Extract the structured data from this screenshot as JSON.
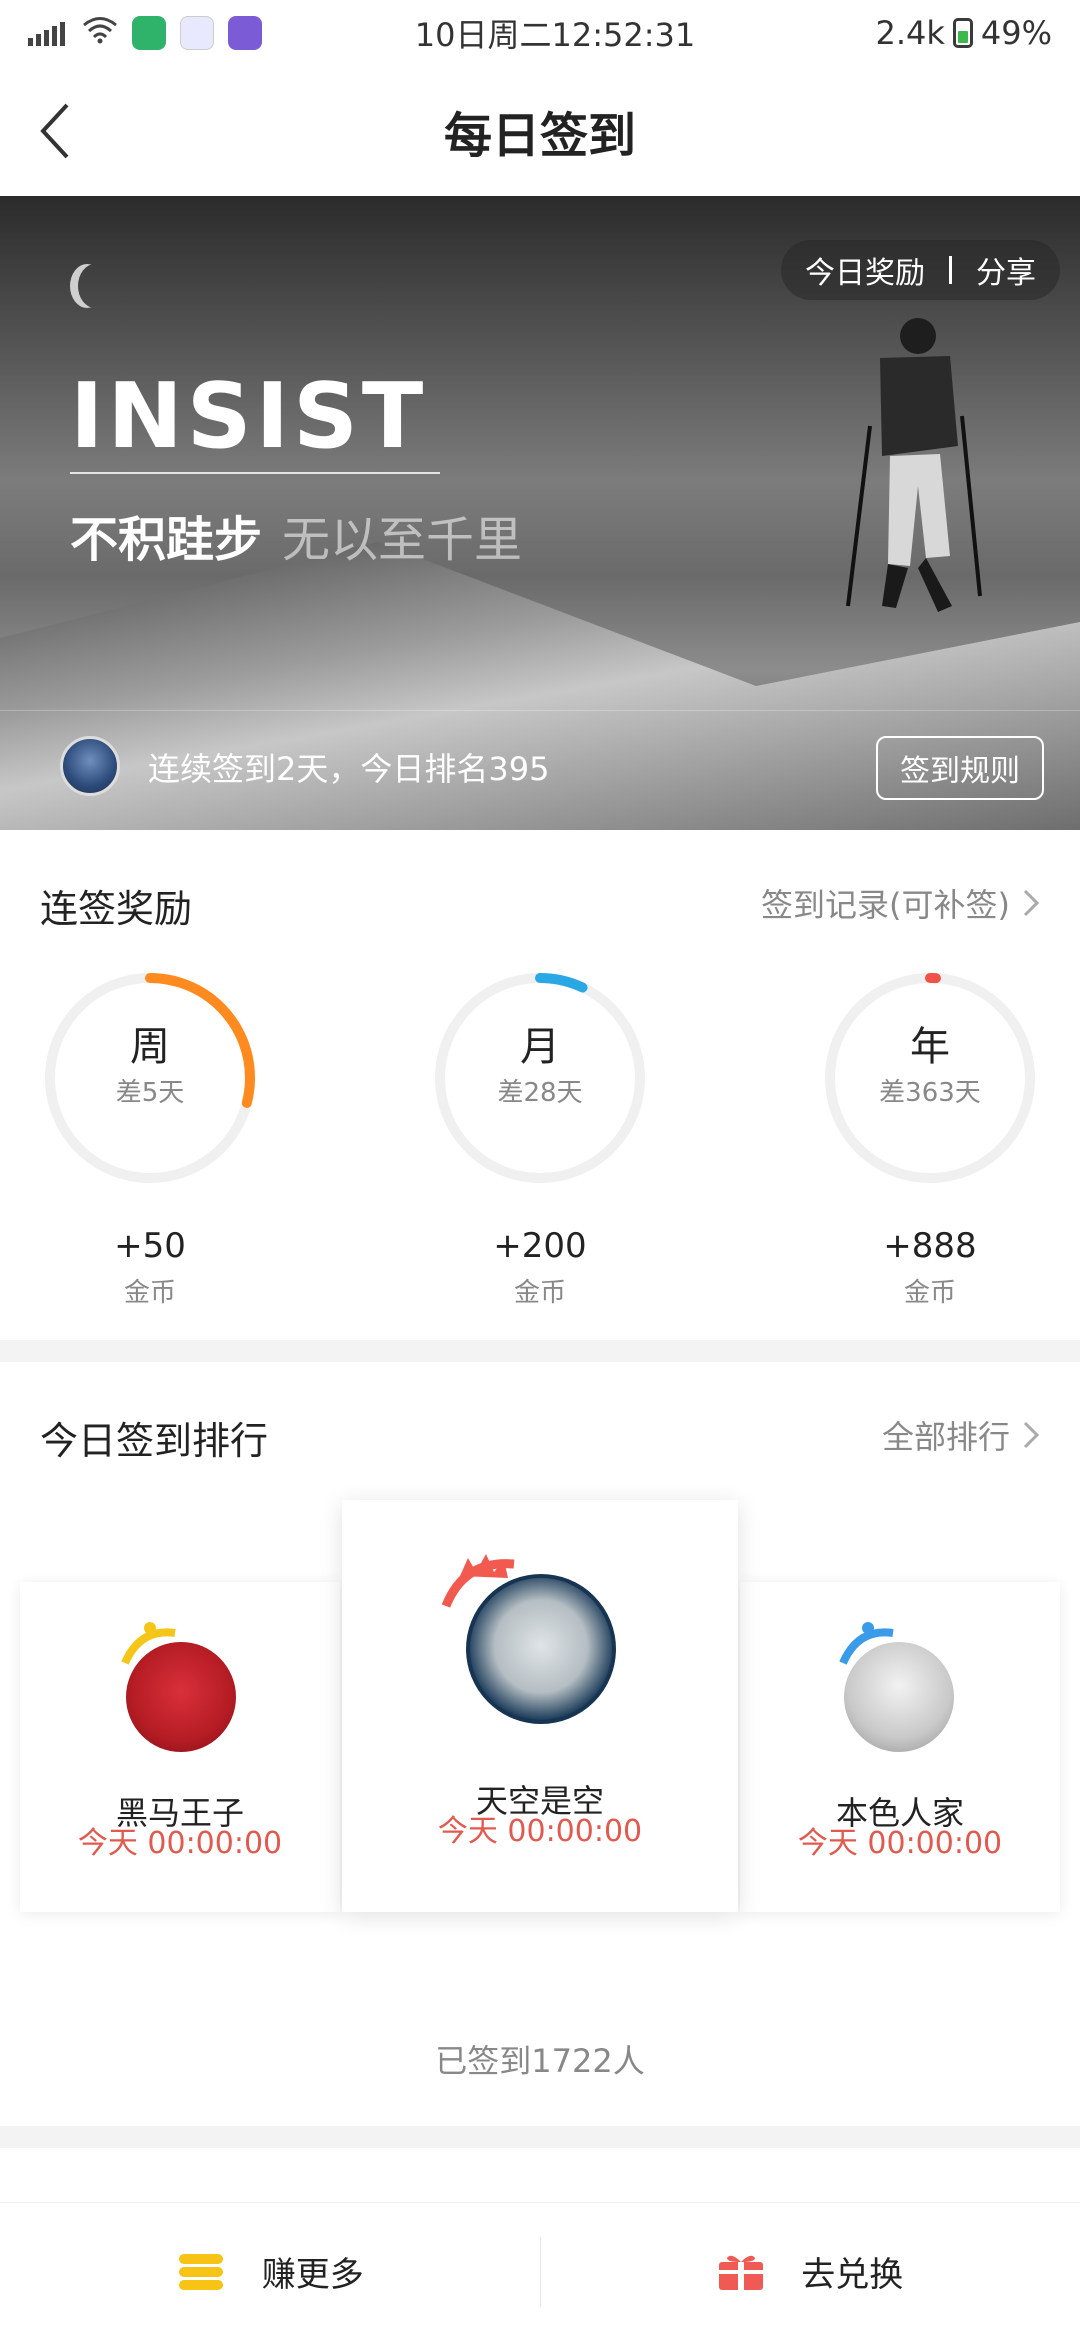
{
  "status_bar": {
    "datetime": "10日周二12:52:31",
    "network_speed": "2.4k",
    "battery": "49%"
  },
  "header": {
    "title": "每日签到"
  },
  "banner": {
    "actions": {
      "today_reward": "今日奖励",
      "share": "分享"
    },
    "headline": "INSIST",
    "slogan_strong": "不积跬步",
    "slogan_light": "无以至千里",
    "streak_text": "连续签到2天，今日排名395",
    "rules_button": "签到规则"
  },
  "streak_rewards": {
    "title": "连签奖励",
    "link": "签到记录(可补签)",
    "items": [
      {
        "label": "周",
        "remaining": "差5天",
        "value": "+50",
        "unit": "金币",
        "progress": 0.29,
        "color": "#ff8a1f"
      },
      {
        "label": "月",
        "remaining": "差28天",
        "value": "+200",
        "unit": "金币",
        "progress": 0.07,
        "color": "#2aa8e6"
      },
      {
        "label": "年",
        "remaining": "差363天",
        "value": "+888",
        "unit": "金币",
        "progress": 0.005,
        "color": "#f0524a"
      }
    ]
  },
  "ranking": {
    "title": "今日签到排行",
    "link": "全部排行",
    "entries": [
      {
        "name": "天空是空",
        "time": "今天 00:00:00",
        "rank": 1
      },
      {
        "name": "黑马王子",
        "time": "今天 00:00:00",
        "rank": 2
      },
      {
        "name": "本色人家",
        "time": "今天 00:00:00",
        "rank": 3
      }
    ],
    "signed_count": "已签到1722人"
  },
  "bottom_bar": {
    "earn_more": "赚更多",
    "exchange": "去兑换"
  }
}
